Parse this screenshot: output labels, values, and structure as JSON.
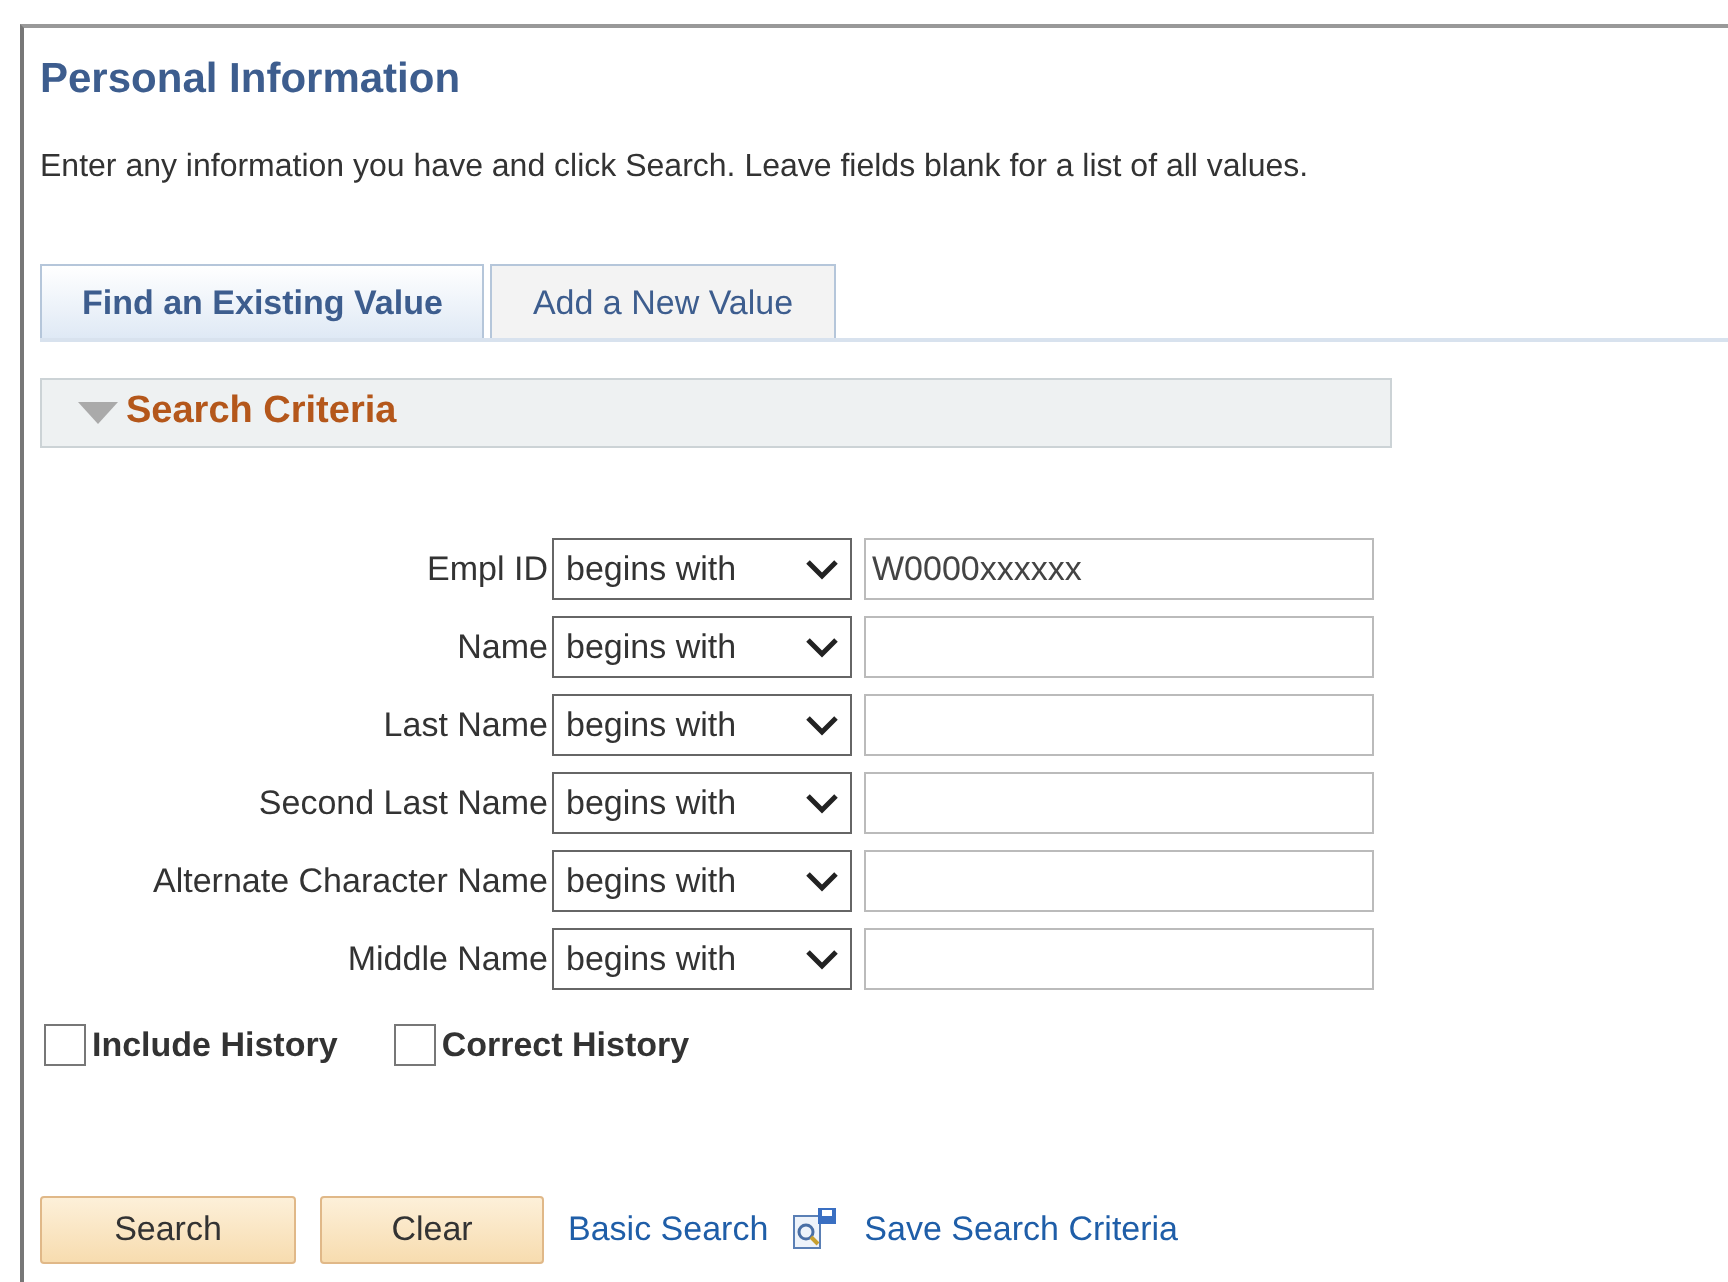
{
  "page": {
    "title": "Personal Information",
    "instructions": "Enter any information you have and click Search. Leave fields blank for a list of all values."
  },
  "tabs": [
    {
      "label": "Find an Existing Value",
      "selected": true
    },
    {
      "label": "Add a New Value",
      "selected": false
    }
  ],
  "section": {
    "title": "Search Criteria",
    "expanded": true
  },
  "fields": [
    {
      "label": "Empl ID",
      "operator": "begins with",
      "value": "W0000xxxxxx"
    },
    {
      "label": "Name",
      "operator": "begins with"
    },
    {
      "label": "Last Name",
      "operator": "begins with"
    },
    {
      "label": "Second Last Name",
      "operator": "begins with"
    },
    {
      "label": "Alternate Character Name",
      "operator": "begins with"
    },
    {
      "label": "Middle Name",
      "operator": "begins with"
    }
  ],
  "checkboxes": [
    {
      "label": "Include History",
      "checked": false
    },
    {
      "label": "Correct History",
      "checked": false
    }
  ],
  "buttons": [
    "Search",
    "Clear"
  ],
  "links": [
    {
      "label": "Basic Search",
      "icon": false
    },
    {
      "label": "Save Search Criteria",
      "icon": true
    }
  ]
}
